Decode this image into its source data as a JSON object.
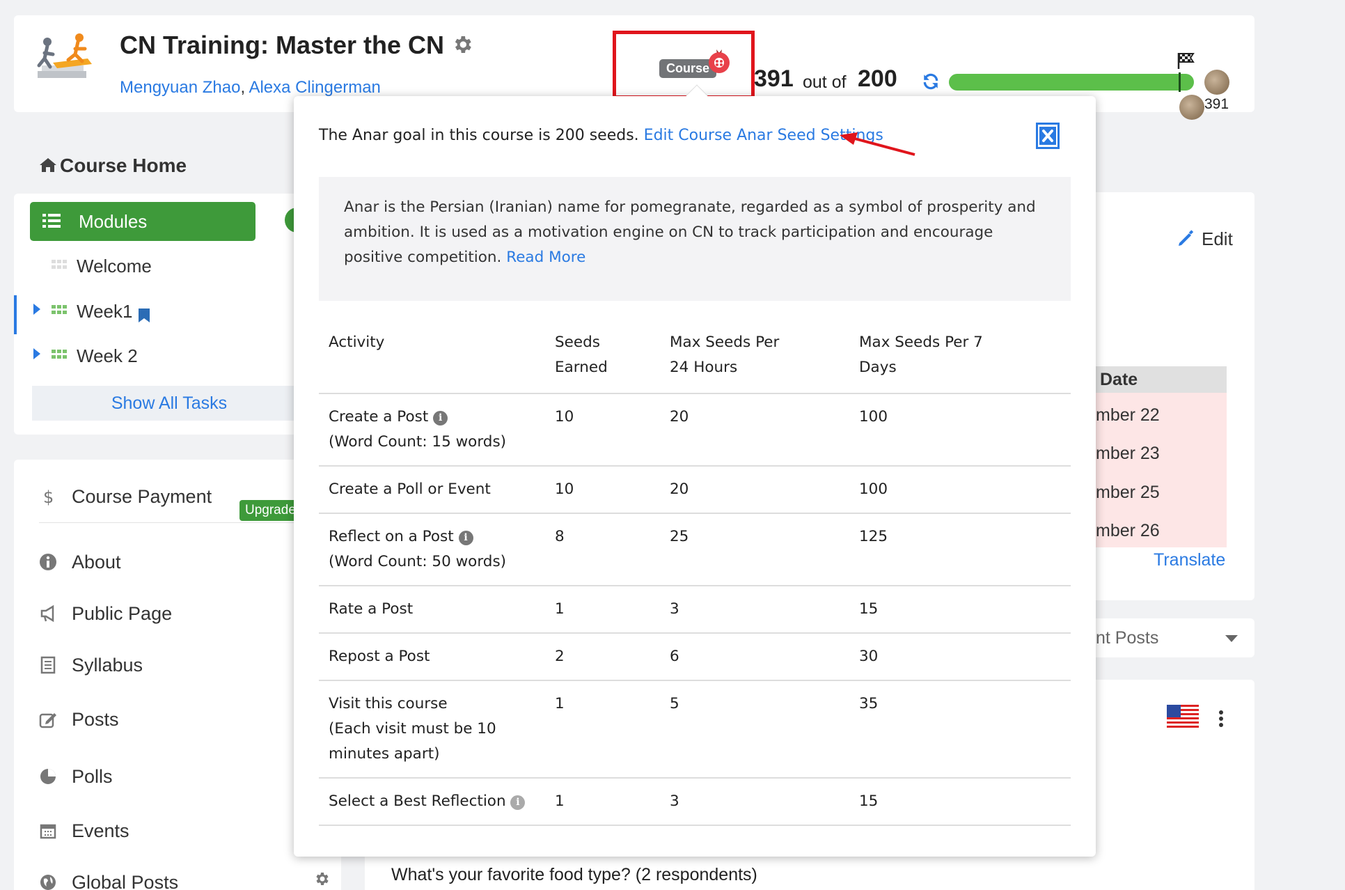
{
  "header": {
    "title": "CN Training: Master the CN",
    "instructors": [
      "Mengyuan Zhao",
      "Alexa Clingerman"
    ],
    "badge_label": "Course",
    "seeds_earned": "391",
    "out_of_label": "out of",
    "seed_goal": "200",
    "progress_fraction": 1.0,
    "avatar_count": "391"
  },
  "nav": {
    "course_home": "Course Home",
    "modules_label": "Modules",
    "modules": [
      {
        "label": "Welcome"
      },
      {
        "label": "Week1"
      },
      {
        "label": "Week 2"
      }
    ],
    "show_all_tasks": "Show All Tasks",
    "items": [
      {
        "label": "Course Payment",
        "icon": "dollar-icon"
      },
      {
        "label": "About",
        "icon": "info-icon"
      },
      {
        "label": "Public Page",
        "icon": "megaphone-icon"
      },
      {
        "label": "Syllabus",
        "icon": "document-icon"
      },
      {
        "label": "Posts",
        "icon": "edit-icon"
      },
      {
        "label": "Polls",
        "icon": "pie-chart-icon"
      },
      {
        "label": "Events",
        "icon": "calendar-icon"
      },
      {
        "label": "Global Posts",
        "icon": "globe-icon"
      }
    ],
    "upgrade_label": "Upgrade"
  },
  "right_panel": {
    "edit_label": "Edit",
    "date_header": "Date",
    "date_rows": [
      "mber 22",
      "mber 23",
      "mber 25",
      "mber 26"
    ],
    "translate_label": "Translate",
    "recent_posts_label": "nt Posts",
    "poll_question": "What's your favorite food type? (2 respondents)"
  },
  "popup": {
    "goal_text": "The Anar goal in this course is 200 seeds.",
    "edit_link": "Edit Course Anar Seed Settings",
    "info_text": "Anar is the Persian (Iranian) name for pomegranate, regarded as a symbol of prosperity and ambition. It is used as a motivation engine on CN to track participation and encourage positive competition.",
    "read_more": "Read More",
    "table": {
      "headers": [
        "Activity",
        "Seeds Earned",
        "Max Seeds Per 24 Hours",
        "Max Seeds Per 7 Days"
      ],
      "rows": [
        {
          "activity": "Create a Post",
          "sub": "(Word Count: 15 words)",
          "seeds": "10",
          "max24": "20",
          "max7": "100"
        },
        {
          "activity": "Create a Poll or Event",
          "sub": "",
          "seeds": "10",
          "max24": "20",
          "max7": "100"
        },
        {
          "activity": "Reflect on a Post",
          "sub": "(Word Count: 50 words)",
          "seeds": "8",
          "max24": "25",
          "max7": "125"
        },
        {
          "activity": "Rate a Post",
          "sub": "",
          "seeds": "1",
          "max24": "3",
          "max7": "15"
        },
        {
          "activity": "Repost a Post",
          "sub": "",
          "seeds": "2",
          "max24": "6",
          "max7": "30"
        },
        {
          "activity": "Visit this course",
          "sub": "(Each visit must be 10 minutes apart)",
          "seeds": "1",
          "max24": "5",
          "max7": "35"
        },
        {
          "activity": "Select a Best Reflection",
          "sub": "",
          "seeds": "1",
          "max24": "3",
          "max7": "15"
        }
      ]
    }
  },
  "colors": {
    "accent_blue": "#2a7ae2",
    "brand_green": "#3e9a3a",
    "progress_green": "#5cbf4a",
    "highlight_red": "#e0151c"
  }
}
